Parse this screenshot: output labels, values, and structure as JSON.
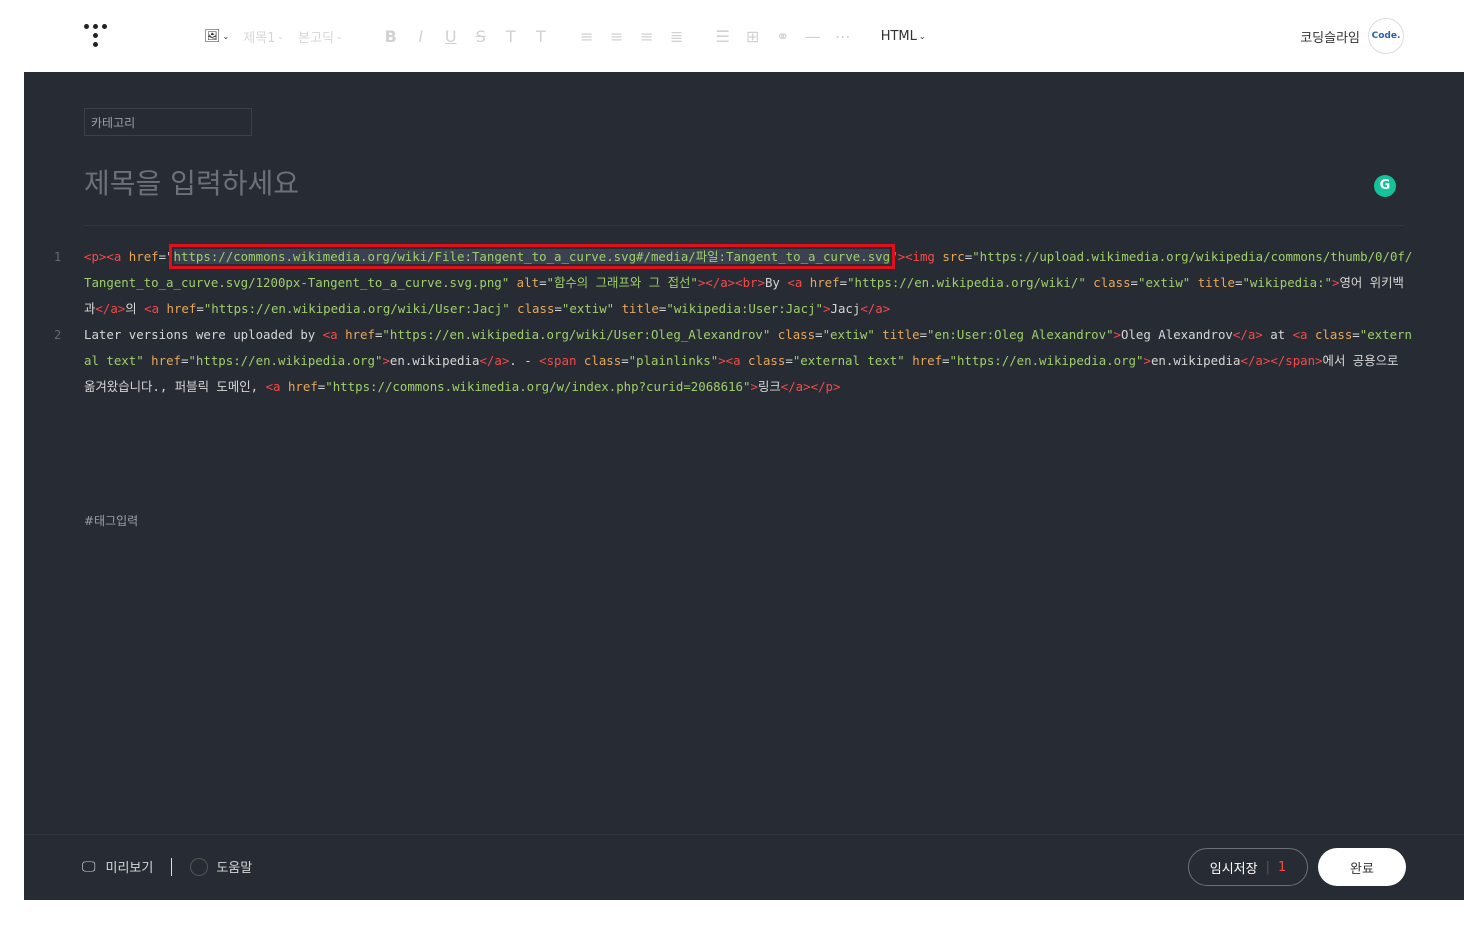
{
  "toolbar": {
    "heading_label": "제목1",
    "font_label": "본고딕",
    "mode_label": "HTML"
  },
  "user": {
    "name": "코딩슬라임",
    "avatar_text": "Code."
  },
  "editor": {
    "category_placeholder": "카테고리",
    "title_placeholder": "제목을 입력하세요",
    "grammarly_letter": "G",
    "tag_placeholder": "#태그입력"
  },
  "code": {
    "line1_no": "1",
    "line2_no": "2",
    "l1": [
      "<p><a",
      " href",
      "=\"",
      "https://commons.wikimedia.org/wiki/File:Tangent_to_a_curve.svg#/media/파일:Tangent_to_a_curve.svg",
      "\"><img",
      " src",
      "=",
      "\"https://upload.wikimedia.org/wikipedia/commons/thumb/0/0f/Tangent_to_a_curve.svg/1200px-Tangent_to_a_curve.svg.png\"",
      " alt",
      "=",
      "\"함수의 그래프와 그 접선\"",
      "></a><br>",
      "By ",
      "<a",
      " href",
      "=",
      "\"https://en.wikipedia.org/wiki/\"",
      " class",
      "=",
      "\"extiw\"",
      " title",
      "=",
      "\"wikipedia:\"",
      ">",
      "영어 위키백과",
      "</a>",
      "의 ",
      "<a",
      " href",
      "=",
      "\"https://en.wikipedia.org/wiki/User:Jacj\"",
      " class",
      "=",
      "\"extiw\"",
      " title",
      "=",
      "\"wikipedia:User:Jacj\"",
      ">",
      "Jacj",
      "</a>"
    ],
    "l2": [
      "Later versions were uploaded by ",
      "<a",
      " href",
      "=",
      "\"https://en.wikipedia.org/wiki/User:Oleg_Alexandrov\"",
      " class",
      "=",
      "\"extiw\"",
      " title",
      "=",
      "\"en:User:Oleg Alexandrov\"",
      ">",
      "Oleg Alexandrov",
      "</a>",
      " at ",
      "<a",
      " class",
      "=",
      "\"external text\"",
      " href",
      "=",
      "\"https://en.wikipedia.org\"",
      ">",
      "en.wikipedia",
      "</a>",
      ". - ",
      "<span",
      " class",
      "=",
      "\"plainlinks\"",
      "><a",
      " class",
      "=",
      "\"external text\"",
      " href",
      "=",
      "\"https://en.wikipedia.org\"",
      ">",
      "en.wikipedia",
      "</a></span>",
      "에서 공용으로 옮겨왔습니다., 퍼블릭 도메인, ",
      "<a",
      " href",
      "=",
      "\"https://commons.wikimedia.org/w/index.php?curid=2068616\"",
      ">",
      "링크",
      "</a>",
      "</p>"
    ]
  },
  "bottom": {
    "preview_label": "미리보기",
    "help_label": "도움말",
    "save_label": "임시저장",
    "save_count": "1",
    "done_label": "완료"
  }
}
